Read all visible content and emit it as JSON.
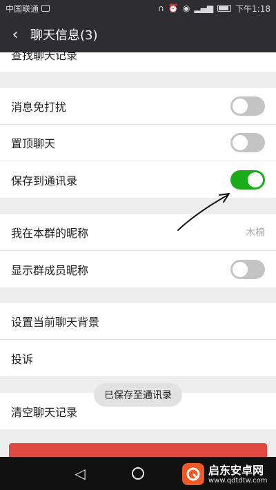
{
  "status_bar": {
    "carrier": "中国联通",
    "time": "下午1:18"
  },
  "header": {
    "back_icon": "‹",
    "title": "聊天信息(3)"
  },
  "partial_row": {
    "label": "查找聊天记录"
  },
  "group1": {
    "rows": [
      {
        "label": "消息免打扰",
        "toggle": "off"
      },
      {
        "label": "置顶聊天",
        "toggle": "off"
      },
      {
        "label": "保存到通讯录",
        "toggle": "on"
      }
    ]
  },
  "group2": {
    "nickname_label": "我在本群的昵称",
    "nickname_value": "木棉",
    "show_names_label": "显示群成员昵称",
    "show_names_toggle": "off"
  },
  "group3": {
    "items": [
      "设置当前聊天背景",
      "投诉"
    ]
  },
  "group4": {
    "clear_label": "清空聊天记录"
  },
  "toast": {
    "text": "已保存至通讯录"
  },
  "watermark": {
    "title": "启东安卓网",
    "subtitle": "www.qdtdtw.com"
  },
  "colors": {
    "toggle_on": "#1aad19",
    "toggle_off": "#c4c4c4",
    "danger": "#e04a43",
    "header_bg": "#2e2e32"
  }
}
